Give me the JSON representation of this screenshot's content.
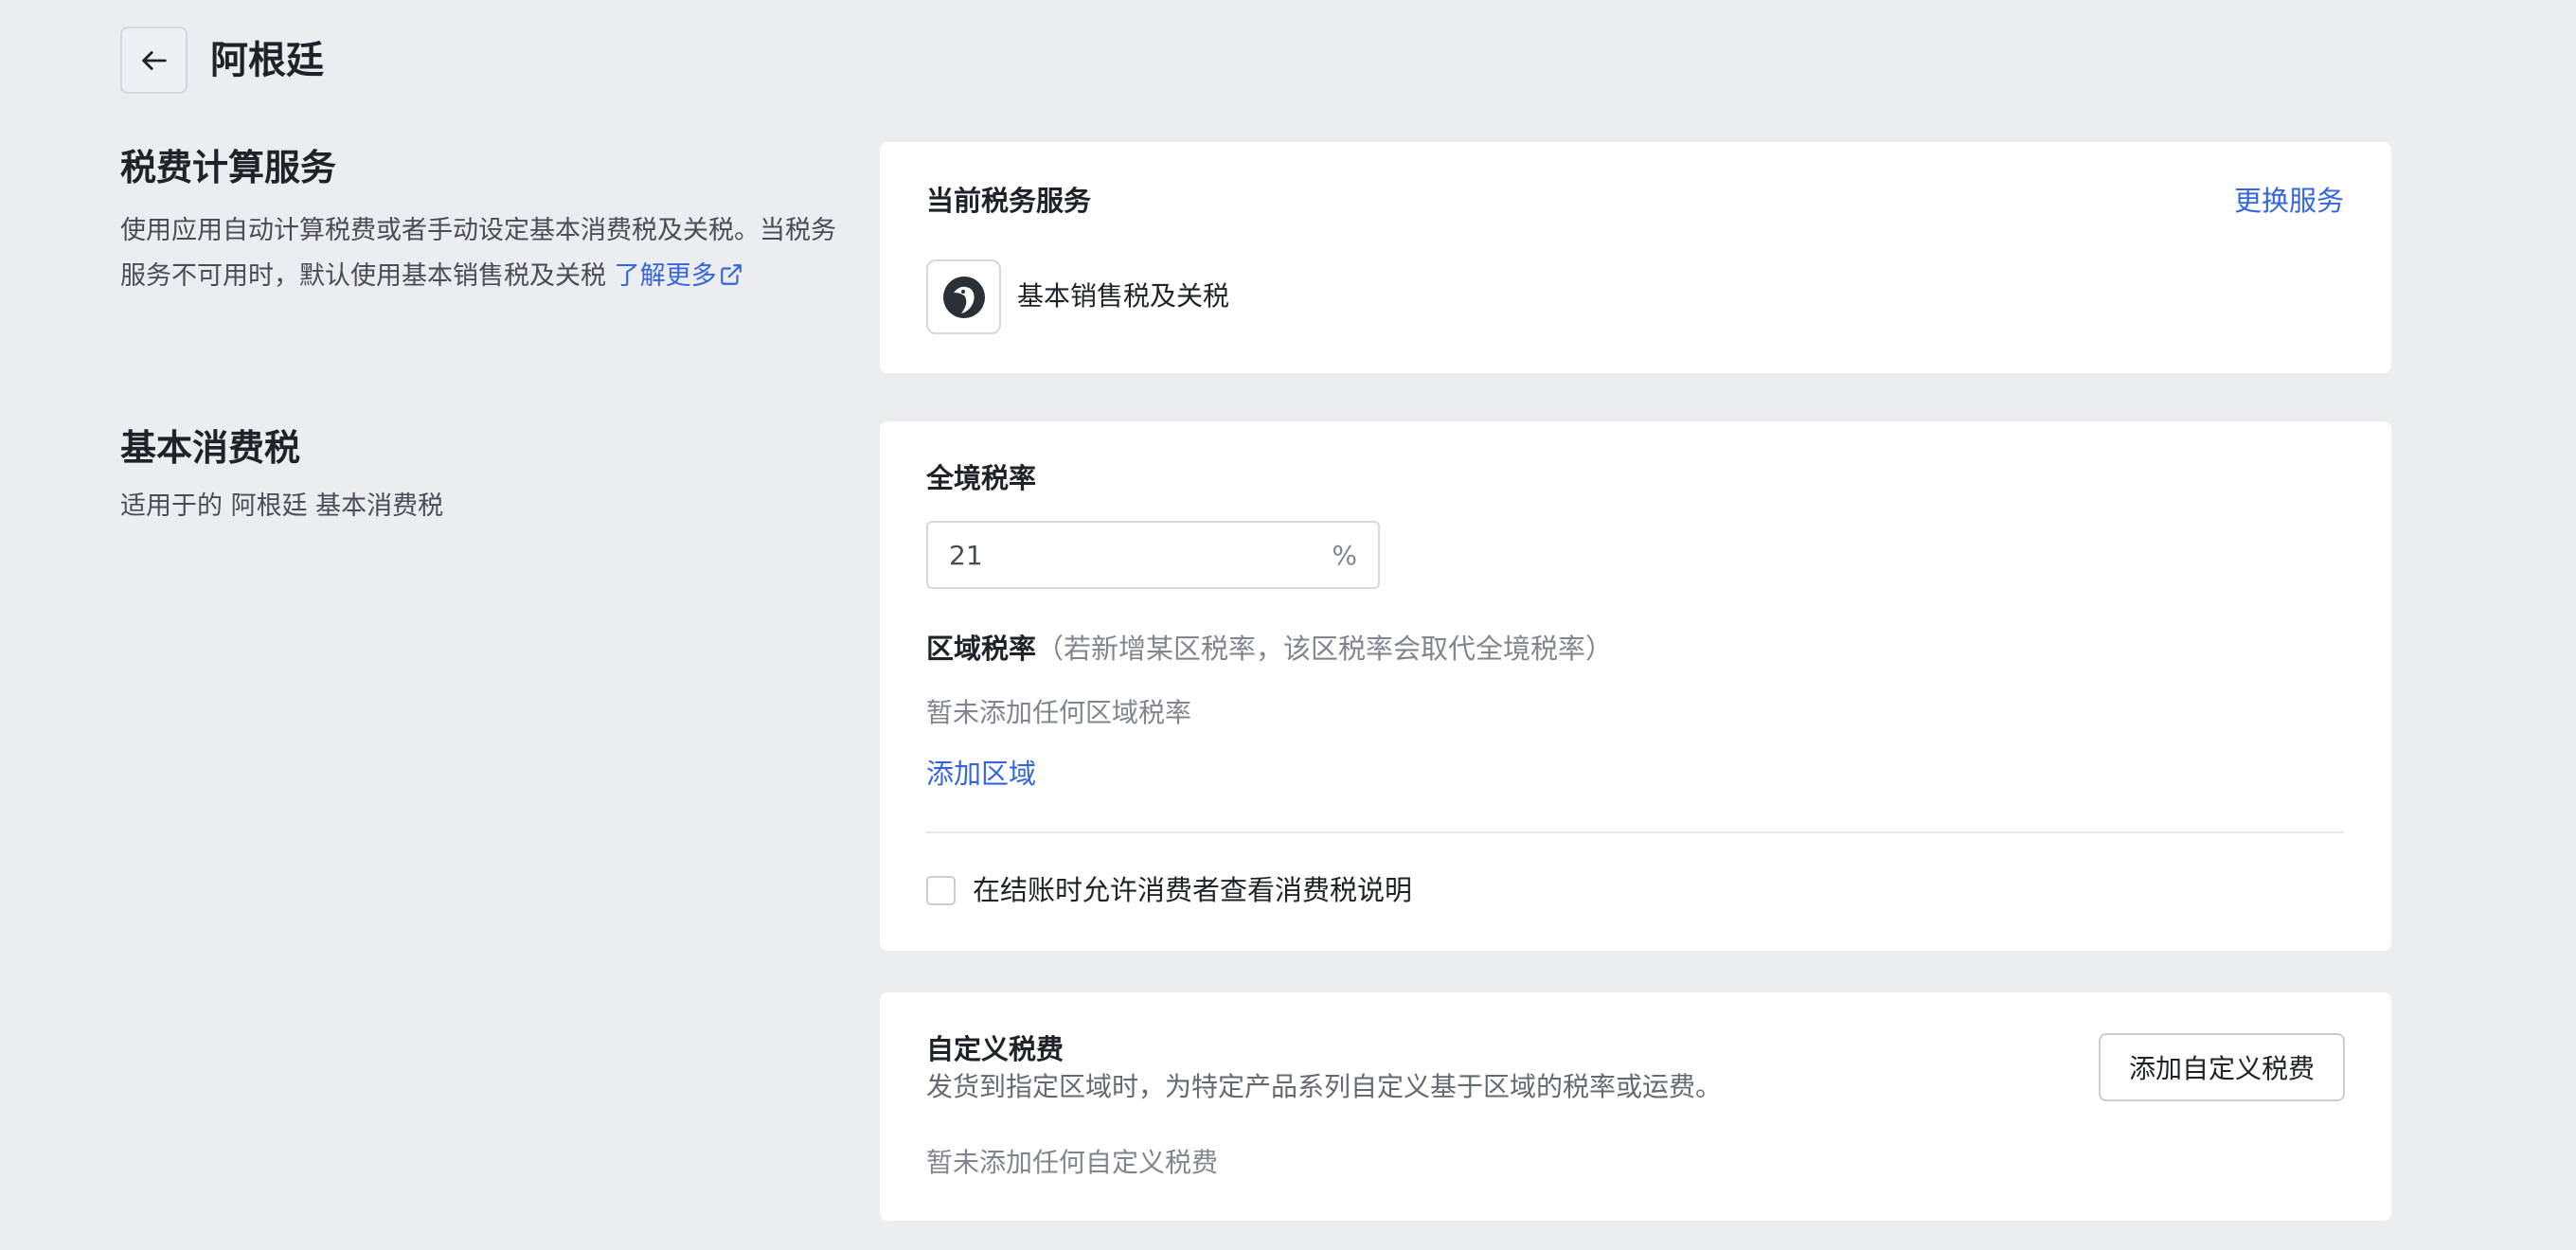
{
  "header": {
    "title": "阿根廷"
  },
  "tax_service_section": {
    "title": "税费计算服务",
    "description": "使用应用自动计算税费或者手动设定基本消费税及关税。当税务服务不可用时，默认使用基本销售税及关税",
    "learn_more": "了解更多",
    "card": {
      "label": "当前税务服务",
      "change_link": "更换服务",
      "service_name": "基本销售税及关税"
    }
  },
  "basic_tax_section": {
    "title": "基本消费税",
    "description": "适用于的 阿根廷 基本消费税",
    "card": {
      "national_rate_label": "全境税率",
      "national_rate_value": "21",
      "rate_suffix": "%",
      "region_rate_label": "区域税率",
      "region_rate_hint": "（若新增某区税率，该区税率会取代全境税率）",
      "region_empty": "暂未添加任何区域税率",
      "add_region": "添加区域",
      "checkbox_label": "在结账时允许消费者查看消费税说明"
    }
  },
  "custom_tax": {
    "title": "自定义税费",
    "description": "发货到指定区域时，为特定产品系列自定义基于区域的税率或运费。",
    "add_button": "添加自定义税费",
    "empty": "暂未添加任何自定义税费"
  },
  "colors": {
    "accent": "#3366e0",
    "background": "#ecedf0",
    "card": "#ffffff"
  },
  "icons": {
    "back": "arrow-left-icon",
    "external": "external-link-icon",
    "service_logo": "bird-logo-icon"
  }
}
